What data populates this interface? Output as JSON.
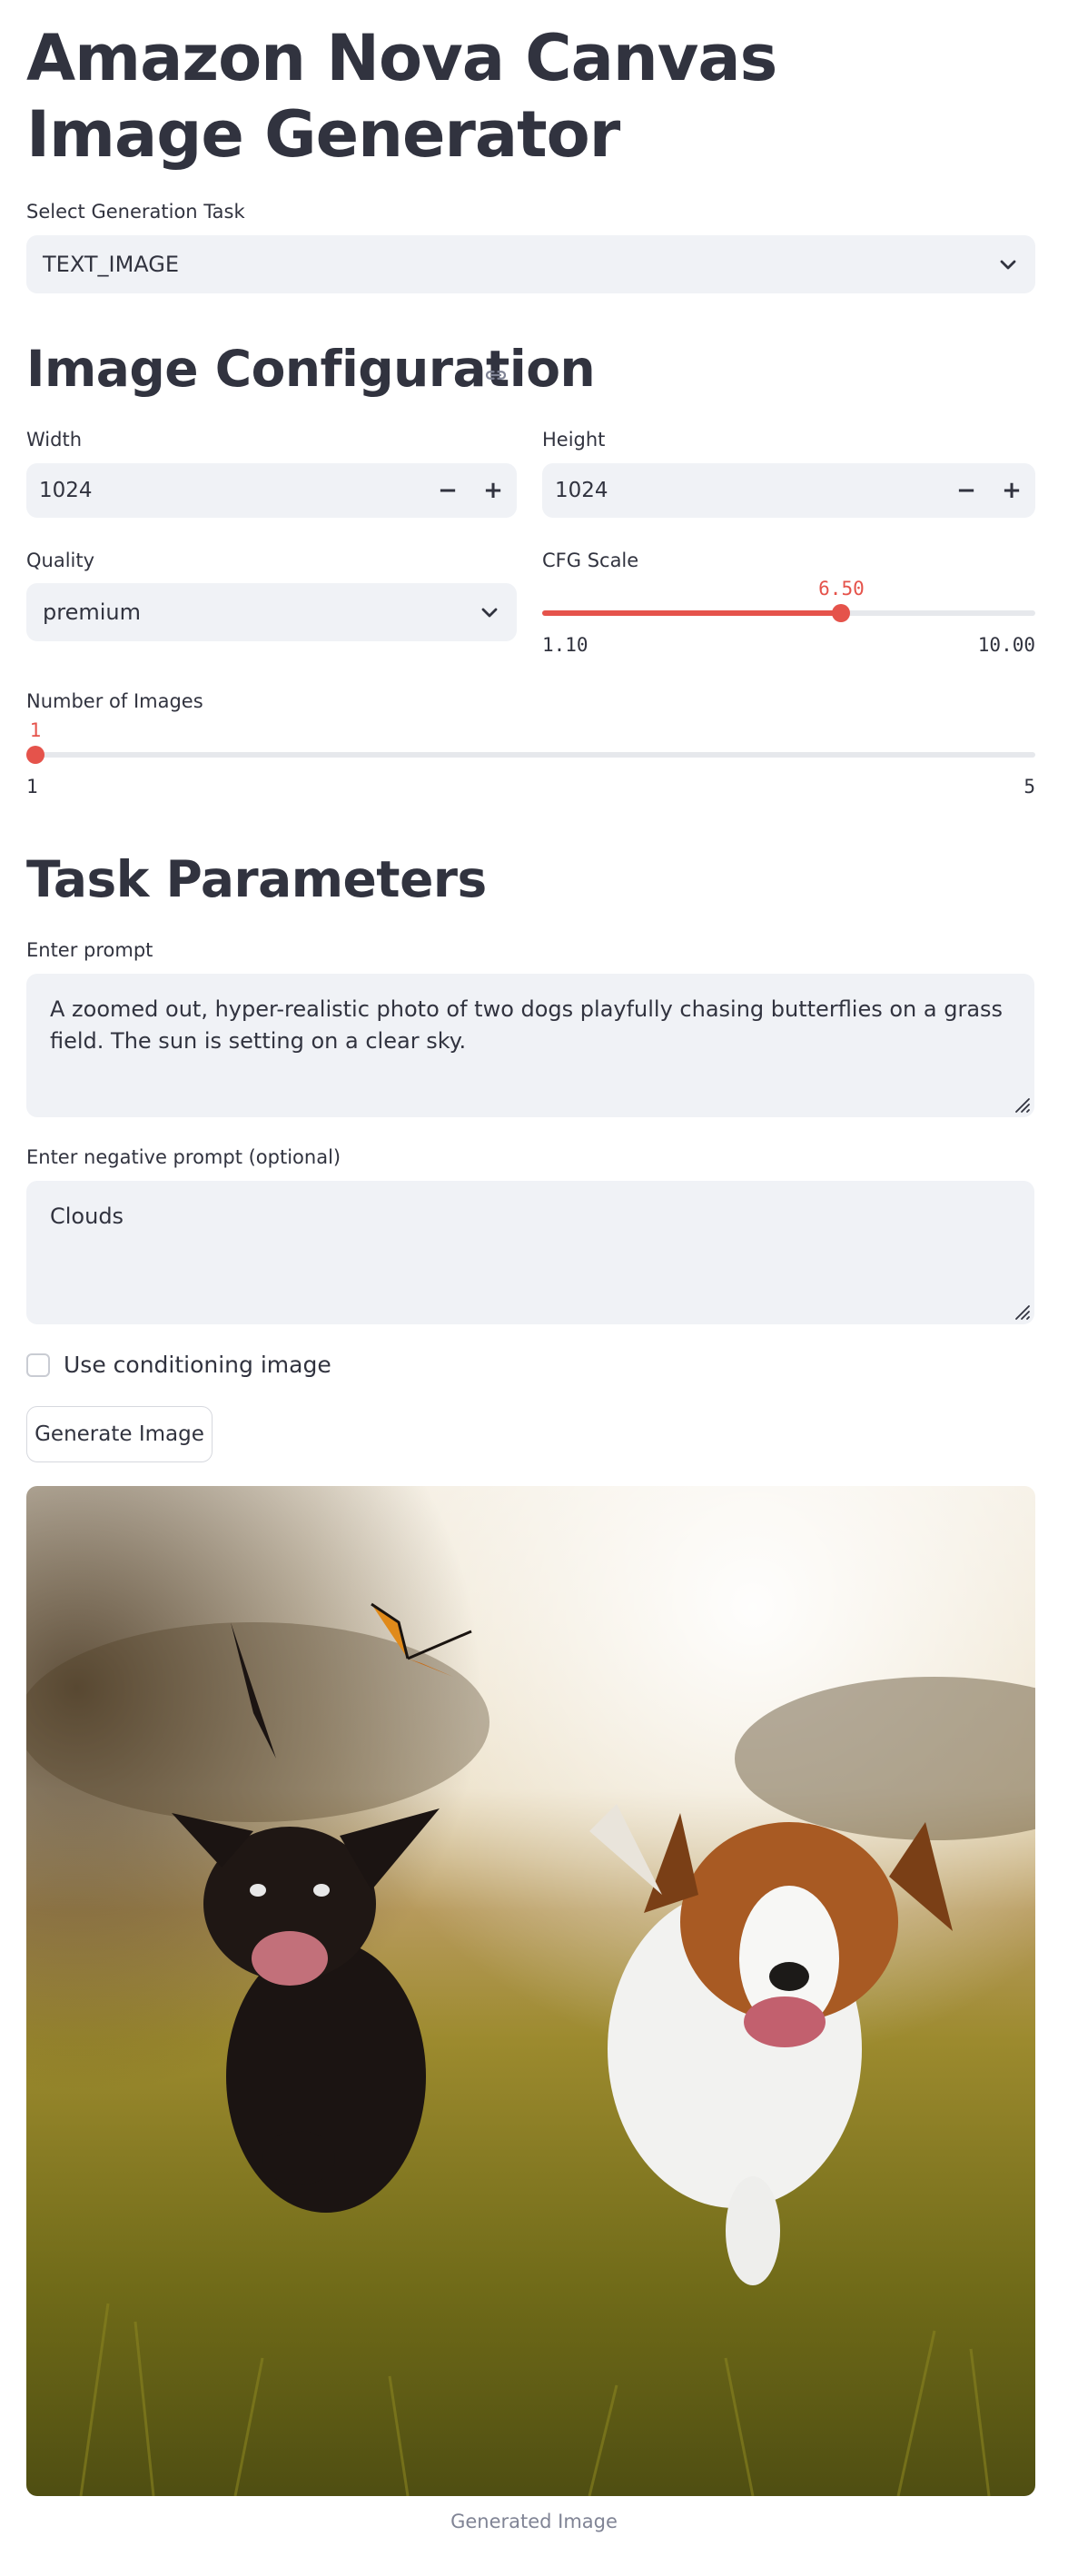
{
  "app": {
    "title": "Amazon Nova Canvas Image Generator"
  },
  "task_select": {
    "label": "Select Generation Task",
    "value": "TEXT_IMAGE",
    "icon": "chevron-down-icon"
  },
  "image_config": {
    "heading": "Image Configuration",
    "width": {
      "label": "Width",
      "value": "1024",
      "minus": "−",
      "plus": "+"
    },
    "height": {
      "label": "Height",
      "value": "1024",
      "minus": "−",
      "plus": "+"
    },
    "quality": {
      "label": "Quality",
      "value": "premium"
    },
    "cfg_scale": {
      "label": "CFG Scale",
      "value": "6.50",
      "min": "1.10",
      "max": "10.00",
      "value_num": 6.5,
      "min_num": 1.1,
      "max_num": 10.0
    },
    "num_images": {
      "label": "Number of Images",
      "value": "1",
      "min": "1",
      "max": "5",
      "value_num": 1,
      "min_num": 1,
      "max_num": 5
    }
  },
  "task_params": {
    "heading": "Task Parameters",
    "prompt": {
      "label": "Enter prompt",
      "value": "A zoomed out, hyper-realistic photo of two dogs playfully chasing butterflies on a grass field. The sun is setting on a clear sky."
    },
    "negative_prompt": {
      "label": "Enter negative prompt (optional)",
      "value": "Clouds"
    },
    "conditioning": {
      "label": "Use conditioning image",
      "checked": false
    }
  },
  "generate_button": {
    "label": "Generate Image"
  },
  "result": {
    "caption": "Generated Image"
  },
  "colors": {
    "accent": "#e5534b",
    "input_bg": "#f0f2f6",
    "text": "#31333f"
  }
}
